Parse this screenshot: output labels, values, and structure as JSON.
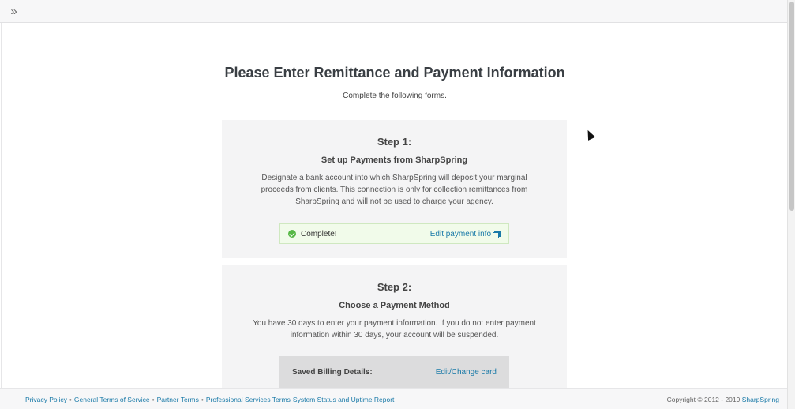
{
  "topbar": {
    "expand_icon": "double-chevron-right-icon",
    "expand_glyph": "»"
  },
  "page": {
    "title": "Please Enter Remittance and Payment Information",
    "subtitle": "Complete the following forms."
  },
  "step1": {
    "title": "Step 1:",
    "heading": "Set up Payments from SharpSpring",
    "description": "Designate a bank account into which SharpSpring will deposit your marginal proceeds from clients. This connection is only for collection remittances from SharpSpring and will not be used to charge your agency.",
    "status_text": "Complete!",
    "status_icon": "check-circle-icon",
    "edit_link": "Edit payment info",
    "edit_icon": "external-link-icon",
    "status_color": "#57b846"
  },
  "step2": {
    "title": "Step 2:",
    "heading": "Choose a Payment Method",
    "description": "You have 30 days to enter your payment information. If you do not enter payment information within 30 days, your account will be suspended.",
    "billing_label": "Saved Billing Details:",
    "billing_link": "Edit/Change card"
  },
  "footer": {
    "links": [
      "Privacy Policy",
      "General Terms of Service",
      "Partner Terms",
      "Professional Services Terms",
      "System Status and Uptime Report"
    ],
    "separator": "•",
    "copyright": "Copyright © 2012 - 2019",
    "brand_link": "SharpSpring"
  },
  "colors": {
    "link": "#1a7aa8",
    "card_bg": "#f4f4f5",
    "success_bg": "#f1fbea"
  }
}
